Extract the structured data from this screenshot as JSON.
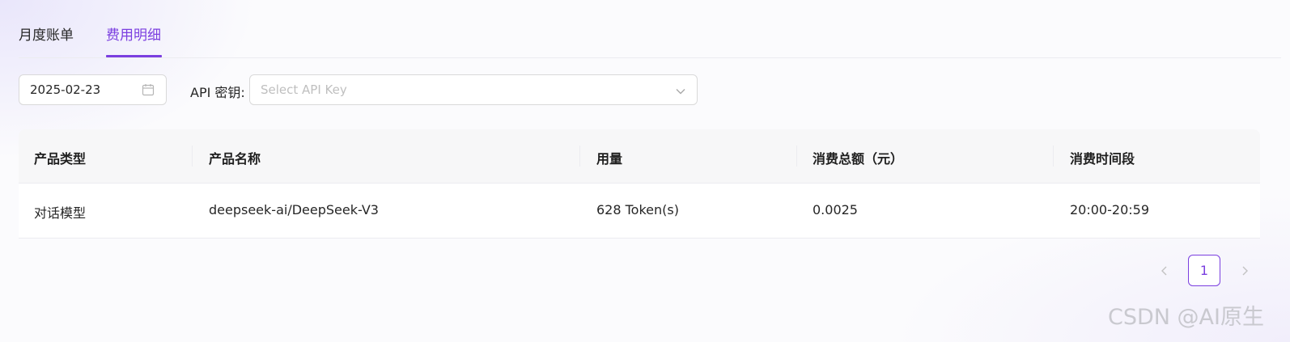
{
  "tabs": [
    {
      "label": "月度账单"
    },
    {
      "label": "费用明细",
      "active": true
    }
  ],
  "filters": {
    "date": "2025-02-23",
    "api_key_label": "API 密钥:",
    "api_key_placeholder": "Select API Key",
    "api_key_value": ""
  },
  "table": {
    "columns": [
      "产品类型",
      "产品名称",
      "用量",
      "消费总额（元）",
      "消费时间段"
    ],
    "rows": [
      [
        "对话模型",
        "deepseek-ai/DeepSeek-V3",
        "628 Token(s)",
        "0.0025",
        "20:00-20:59"
      ]
    ]
  },
  "pagination": {
    "current_page": "1"
  },
  "watermark": "CSDN @AI原生",
  "colors": {
    "accent": "#7b3fe0",
    "border": "#d9d9d9",
    "header_bg": "#f7f7f8"
  },
  "icons": {
    "date": "calendar-icon",
    "select": "chevron-down-icon",
    "prev": "chevron-left-icon",
    "next": "chevron-right-icon"
  }
}
